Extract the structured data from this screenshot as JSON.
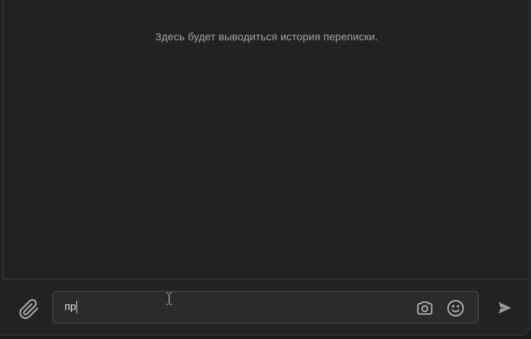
{
  "history": {
    "empty_text": "Здесь будет выводиться история переписки."
  },
  "composer": {
    "message_value": "пр",
    "icons": {
      "attach": "paperclip-icon",
      "camera": "camera-icon",
      "emoji": "smile-icon",
      "send": "send-icon"
    }
  },
  "colors": {
    "background": "#222222",
    "input_background": "#2b2b2b",
    "icon": "#a9a9a9",
    "text": "#e2e2e2",
    "muted_text": "#a3a3a3"
  }
}
